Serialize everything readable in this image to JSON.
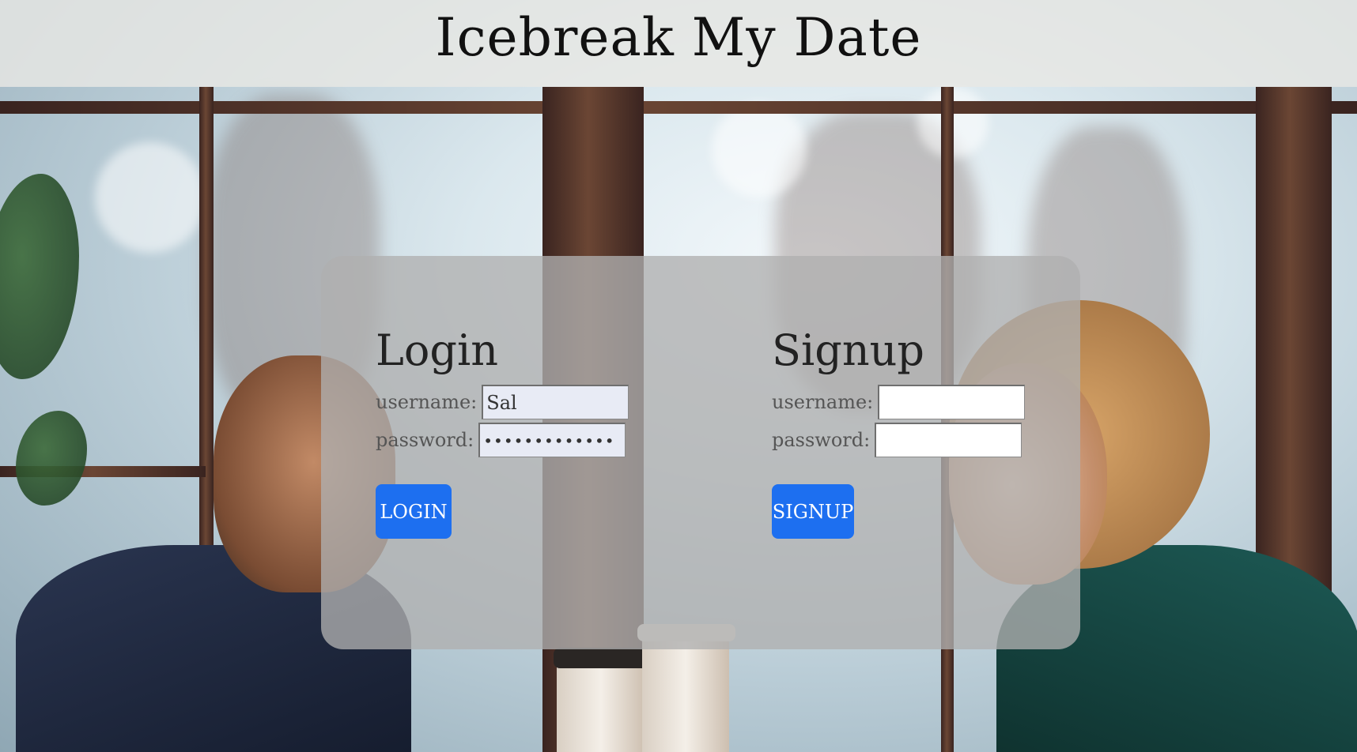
{
  "header": {
    "title": "Icebreak My Date"
  },
  "login": {
    "title": "Login",
    "username_label": "username:",
    "username_value": "Sal",
    "password_label": "password:",
    "password_value": "•••••••••••••",
    "button_label": "login"
  },
  "signup": {
    "title": "Signup",
    "username_label": "username:",
    "username_value": "",
    "password_label": "password:",
    "password_value": "",
    "button_label": "signup"
  },
  "colors": {
    "accent": "#1d6ff0",
    "header_band": "#e8e8e4",
    "panel": "#b0b0b0"
  },
  "background": {
    "description_icon": "cafe-couple-photo"
  }
}
